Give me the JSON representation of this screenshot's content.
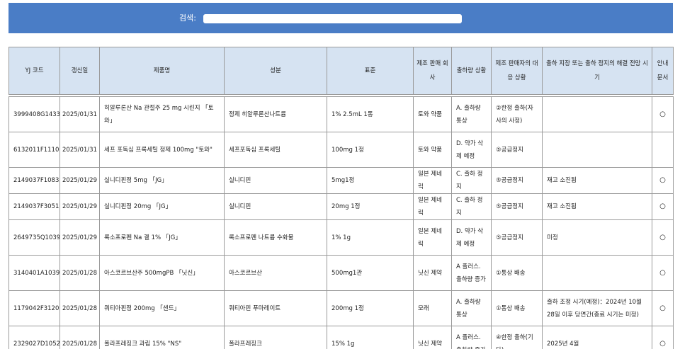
{
  "colors": {
    "header_bar": "#4a7dc6",
    "table_header": "#d6e3f2",
    "border": "#9a9a9a"
  },
  "search": {
    "label": "검색:",
    "value": "",
    "placeholder": ""
  },
  "table": {
    "columns": [
      "YJ 코드",
      "갱신일",
      "제품명",
      "성분",
      "표준",
      "제조 판매 회사",
      "출하량 상황",
      "제조 판매자의 대응 상황",
      "출하 지장 또는 출하 정지의 해결 전망 시기",
      "안내 문서"
    ],
    "rows": [
      {
        "yj": "3999408G1433",
        "date": "2025/01/31",
        "product": "히알루론산 Na 관절주 25 mg 시린지 「토와」",
        "ingredient": "정제 히알루론산나트륨",
        "standard": "1% 2.5mL 1통",
        "company": "토와 약품",
        "shipment": "A. 출하량 통상",
        "response": "②한정 출하(자사의 사정)",
        "outlook": "",
        "doc": "○"
      },
      {
        "yj": "6132011F1110",
        "date": "2025/01/31",
        "product": "세프 포독심 프록세틸 정제 100mg \"토와\"",
        "ingredient": "세프포독심 프록세틸",
        "standard": "100mg 1정",
        "company": "토와 약품",
        "shipment": "D. 약가 삭제 예정",
        "response": "⑤공급정지",
        "outlook": "",
        "doc": ""
      },
      {
        "yj": "2149037F1083",
        "date": "2025/01/29",
        "product": "실니디핀정 5mg 「JG」",
        "ingredient": "실니디핀",
        "standard": "5mg1정",
        "company": "일본 제네릭",
        "shipment": "C. 출하 정지",
        "response": "⑤공급정지",
        "outlook": "재고 소진됨",
        "doc": "○"
      },
      {
        "yj": "2149037F3051",
        "date": "2025/01/29",
        "product": "실니디핀정 20mg 「JG」",
        "ingredient": "실니디핀",
        "standard": "20mg 1정",
        "company": "일본 제네릭",
        "shipment": "C. 출하 정지",
        "response": "⑤공급정지",
        "outlook": "재고 소진됨",
        "doc": "○"
      },
      {
        "yj": "2649735Q1039",
        "date": "2025/01/29",
        "product": "록소프로펜 Na 겔 1% 「JG」",
        "ingredient": "록소프로펜 나트륨 수화물",
        "standard": "1% 1g",
        "company": "일본 제네릭",
        "shipment": "D. 약가 삭제 예정",
        "response": "⑤공급정지",
        "outlook": "미정",
        "doc": "○"
      },
      {
        "yj": "3140401A1039",
        "date": "2025/01/28",
        "product": "아스코르브산주 500mgPB 「닛신」",
        "ingredient": "아스코르브산",
        "standard": "500mg1관",
        "company": "닛신 제약",
        "shipment": "A 플러스. 출하량 증가",
        "response": "①통상 배송",
        "outlook": "",
        "doc": "○"
      },
      {
        "yj": "1179042F3120",
        "date": "2025/01/28",
        "product": "쿼티아핀정 200mg 「샌드」",
        "ingredient": "쿼티아핀 푸마레이트",
        "standard": "200mg 1정",
        "company": "모래",
        "shipment": "A. 출하량 통상",
        "response": "①통상 배송",
        "outlook": "출하 조정 시기(예정)：2024년 10월 28일 이후 당면간(종료 시기는 미정)",
        "doc": "○"
      },
      {
        "yj": "2329027D1052",
        "date": "2025/01/28",
        "product": "폴라프레징크 과립 15% \"NS\"",
        "ingredient": "폴라프레징크",
        "standard": "15% 1g",
        "company": "닛신 제약",
        "shipment": "A 플러스. 출하량 증가",
        "response": "④한정 출하(기타)",
        "outlook": "2025년 4월",
        "doc": "○"
      }
    ]
  }
}
